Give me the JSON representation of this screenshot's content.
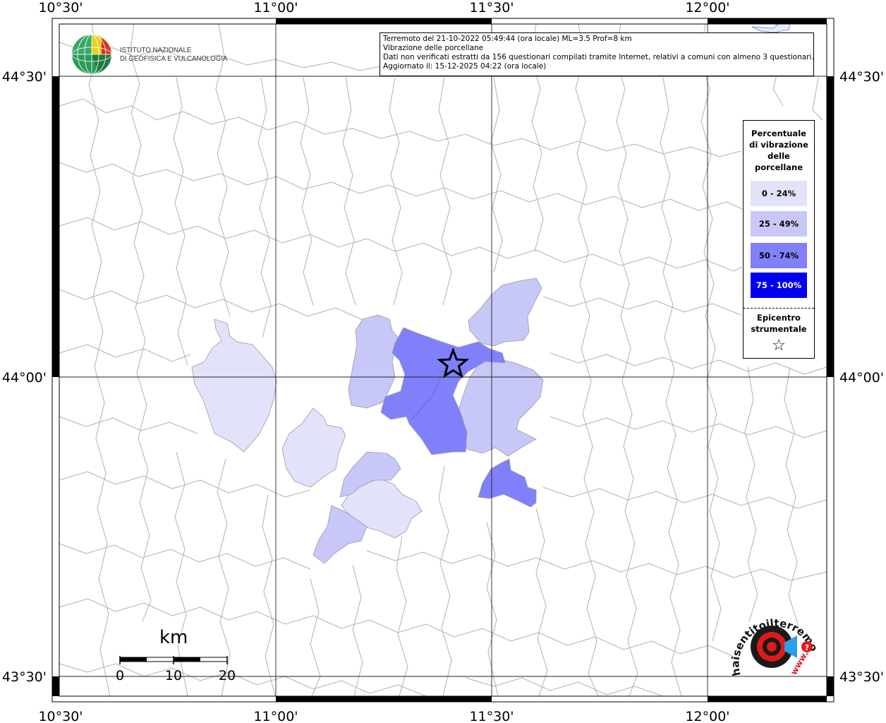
{
  "map": {
    "type": "macroseismic-map",
    "lon_ticks": [
      "10°30'",
      "11°00'",
      "11°30'",
      "12°00'"
    ],
    "lat_ticks": [
      "44°30'",
      "44°00'",
      "43°30'"
    ],
    "epicenter": {
      "lon": 11.41,
      "lat": 44.02,
      "symbol": "star"
    },
    "region_colors": {
      "class_0_24": "#e2e2fa",
      "class_25_49": "#c7c7f8",
      "class_50_74": "#8080fa",
      "class_75_100": "#0000ee"
    },
    "border_color": "#b0b0b0",
    "grid_color": "#222222"
  },
  "info": {
    "line1": "Terremoto del 21-10-2022 05:49:44 (ora locale) ML=3.5 Prof=8 km",
    "line2": "Vibrazione delle porcellane",
    "line3": "Dati non verificati estratti da 156 questionari compilati tramite Internet, relativi a comuni con almeno 3 questionari.",
    "line4": "Aggiornato il: 15-12-2025 04:22 (ora locale)"
  },
  "logo": {
    "icon": "ingv-globe-icon",
    "line1": "ISTITUTO NAZIONALE",
    "line2": "DI GEOFISICA E VULCANOLOGIA"
  },
  "legend": {
    "title_lines": [
      "Percentuale",
      "di vibrazione",
      "delle",
      "porcellane"
    ],
    "items": [
      {
        "label": "0 - 24%",
        "color": "#e2e2fa",
        "text_color": "#000000"
      },
      {
        "label": "25 - 49%",
        "color": "#c7c7f8",
        "text_color": "#000000"
      },
      {
        "label": "50 - 74%",
        "color": "#8080fa",
        "text_color": "#000000"
      },
      {
        "label": "75 - 100%",
        "color": "#0000ee",
        "text_color": "#ffffff"
      }
    ],
    "epicenter_lines": [
      "Epicentro",
      "strumentale"
    ],
    "epicenter_symbol": "☆"
  },
  "scale": {
    "unit": "km",
    "labels": [
      "0",
      "10",
      "20"
    ]
  },
  "stamp": {
    "text": "haisentitoilterremoto.it",
    "url": "www.",
    "icon": "megaphone-target-icon"
  }
}
